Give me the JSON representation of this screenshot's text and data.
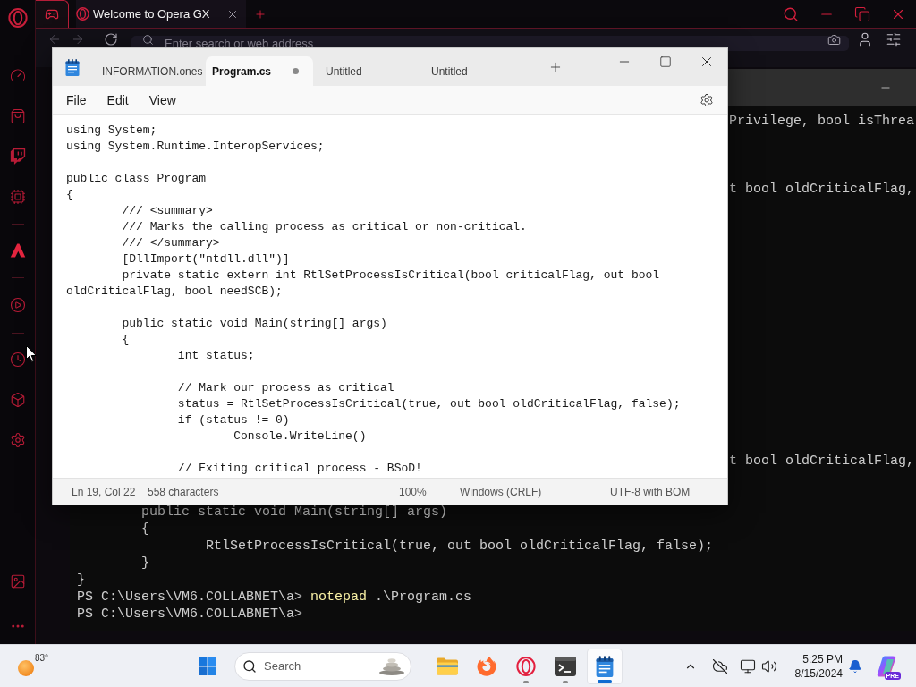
{
  "browser": {
    "tabs": [
      {
        "label": "Welcome to Opera GX",
        "selected": true
      }
    ],
    "address_bar": {
      "placeholder": "Enter search or web address"
    }
  },
  "terminal": {
    "right_fragments": [
      "Privilege, bool isThrea",
      "t bool oldCriticalFlag,",
      "t bool oldCriticalFlag,"
    ],
    "lines": [
      {
        "kind": "code",
        "text": "        public static void Main(string[] args)"
      },
      {
        "kind": "code",
        "text": "        {"
      },
      {
        "kind": "code",
        "text": "                RtlSetProcessIsCritical(true, out bool oldCriticalFlag, false);"
      },
      {
        "kind": "code",
        "text": "        }"
      },
      {
        "kind": "code",
        "text": "}"
      },
      {
        "kind": "prompt",
        "prompt": "PS C:\\Users\\VM6.COLLABNET\\a>",
        "command": "notepad",
        "args": ".\\Program.cs"
      },
      {
        "kind": "prompt",
        "prompt": "PS C:\\Users\\VM6.COLLABNET\\a>"
      }
    ]
  },
  "notepad": {
    "tabs": [
      {
        "label": "INFORMATION.ones",
        "selected": false,
        "modified": false
      },
      {
        "label": "Program.cs",
        "selected": true,
        "modified": true
      },
      {
        "label": "Untitled",
        "selected": false,
        "modified": false
      },
      {
        "label": "Untitled",
        "selected": false,
        "modified": false
      }
    ],
    "menu": [
      "File",
      "Edit",
      "View"
    ],
    "content": "using System;\nusing System.Runtime.InteropServices;\n\npublic class Program\n{\n        /// <summary>\n        /// Marks the calling process as critical or non-critical.\n        /// </summary>\n        [DllImport(\"ntdll.dll\")]\n        private static extern int RtlSetProcessIsCritical(bool criticalFlag, out bool oldCriticalFlag, bool needSCB);\n\n        public static void Main(string[] args)\n        {\n                int status;\n\n                // Mark our process as critical\n                status = RtlSetProcessIsCritical(true, out bool oldCriticalFlag, false);\n                if (status != 0)\n                        Console.WriteLine()\n\n                // Exiting critical process - BSoD!",
    "status_bar": {
      "position": "Ln 19, Col 22",
      "characters": "558 characters",
      "zoom": "100%",
      "line_ending": "Windows (CRLF)",
      "encoding": "UTF-8 with BOM"
    }
  },
  "taskbar": {
    "weather": {
      "temperature": "83°"
    },
    "search": {
      "placeholder": "Search"
    },
    "apps": [
      {
        "running": false,
        "selected": false
      },
      {
        "running": false,
        "selected": false
      },
      {
        "running": true,
        "selected": false
      },
      {
        "running": true,
        "selected": false
      },
      {
        "running": true,
        "selected": true
      }
    ],
    "clock": {
      "time": "5:25 PM",
      "date": "8/15/2024"
    },
    "copilot": {
      "badge": "PRE"
    }
  }
}
